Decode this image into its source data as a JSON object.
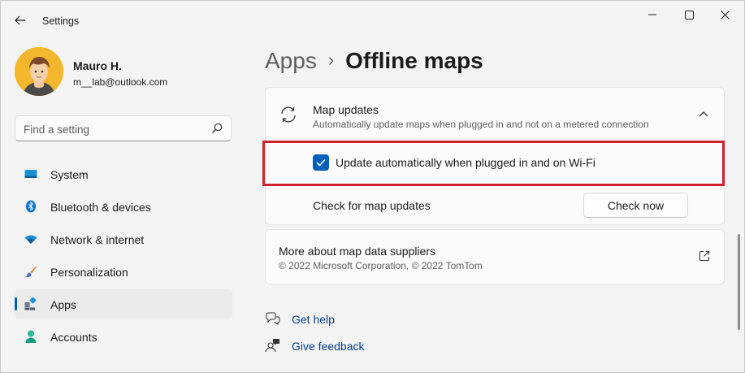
{
  "window": {
    "title": "Settings"
  },
  "user": {
    "name": "Mauro H.",
    "email": "m__lab@outlook.com"
  },
  "search": {
    "placeholder": "Find a setting"
  },
  "nav": [
    {
      "label": "System",
      "icon": "monitor-icon"
    },
    {
      "label": "Bluetooth & devices",
      "icon": "bluetooth-icon"
    },
    {
      "label": "Network & internet",
      "icon": "wifi-icon"
    },
    {
      "label": "Personalization",
      "icon": "brush-icon"
    },
    {
      "label": "Apps",
      "icon": "apps-icon",
      "active": true
    },
    {
      "label": "Accounts",
      "icon": "person-icon"
    }
  ],
  "breadcrumb": {
    "parent": "Apps",
    "separator": "›",
    "current": "Offline maps"
  },
  "map_updates": {
    "title": "Map updates",
    "subtitle": "Automatically update maps when plugged in and not on a metered connection",
    "auto_update_label": "Update automatically when plugged in and on Wi-Fi",
    "auto_update_checked": true,
    "check_label": "Check for map updates",
    "check_button": "Check now"
  },
  "suppliers": {
    "title": "More about map data suppliers",
    "subtitle": "© 2022 Microsoft Corporation, © 2022 TomTom"
  },
  "links": {
    "help": "Get help",
    "feedback": "Give feedback"
  },
  "colors": {
    "accent": "#005fb8",
    "highlight": "#d0202b",
    "link": "#003e92"
  }
}
